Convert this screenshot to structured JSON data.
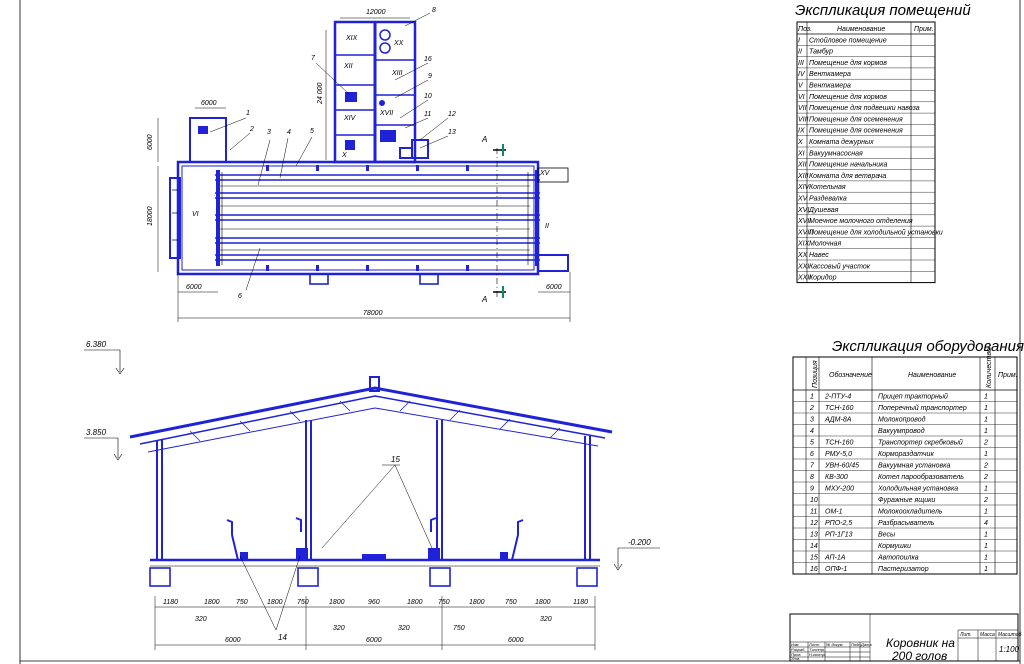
{
  "plan": {
    "dims": {
      "d_top": "12000",
      "d_top_left": "6000",
      "d_left_upper": "6000",
      "d_left_main": "18000",
      "d_vert_mid": "24 000",
      "d_bottom_left": "6000",
      "d_bottom_right": "6000",
      "d_total": "78000"
    },
    "callouts": [
      "1",
      "2",
      "3",
      "4",
      "5",
      "6",
      "7",
      "8",
      "9",
      "10",
      "11",
      "12",
      "13",
      "16"
    ],
    "section_marks": [
      "A",
      "A"
    ],
    "room_labels": [
      "VI",
      "II",
      "XIX",
      "XX",
      "XII",
      "XIII",
      "XIV",
      "XVII",
      "X",
      "XV"
    ]
  },
  "rooms_table": {
    "title": "Экспликация помещений",
    "headers": [
      "Поз.",
      "Наименование",
      "Прим."
    ],
    "rows": [
      [
        "I",
        "Стойловое помещение"
      ],
      [
        "II",
        "Тамбур"
      ],
      [
        "III",
        "Помещение для кормов"
      ],
      [
        "IV",
        "Венткамера"
      ],
      [
        "V",
        "Венткамера"
      ],
      [
        "VI",
        "Помещение для кормов"
      ],
      [
        "VII",
        "Помещение для подвешки навоза"
      ],
      [
        "VIII",
        "Помещение для осеменения"
      ],
      [
        "IX",
        "Помещение для осеменения"
      ],
      [
        "X",
        "Комната дежурных"
      ],
      [
        "XI",
        "Вакуумнасосная"
      ],
      [
        "XII",
        "Помещение начальника"
      ],
      [
        "XIII",
        "Комната для ветврача"
      ],
      [
        "XIV",
        "Котельная"
      ],
      [
        "XV",
        "Раздевалка"
      ],
      [
        "XVI",
        "Душевая"
      ],
      [
        "XVII",
        "Моечное молочного отделения"
      ],
      [
        "XVIII",
        "Помещение для холодильной установки"
      ],
      [
        "XIX",
        "Молочная"
      ],
      [
        "XX",
        "Навес"
      ],
      [
        "XXI",
        "Кассовый участок"
      ],
      [
        "XXII",
        "Коридор"
      ]
    ]
  },
  "equipment_table": {
    "title": "Экспликация оборудования",
    "headers": [
      "Позиция",
      "Обозначение",
      "Наименование",
      "Количество",
      "Прим."
    ],
    "rows": [
      [
        "1",
        "2-ПТУ-4",
        "Прицеп тракторный",
        "1"
      ],
      [
        "2",
        "ТСН-160",
        "Поперечный транспортер",
        "1"
      ],
      [
        "3",
        "АДМ-8А",
        "Молокопровод",
        "1"
      ],
      [
        "4",
        "",
        "Вакуумпровод",
        "1"
      ],
      [
        "5",
        "ТСН-160",
        "Транспортер скребковый",
        "2"
      ],
      [
        "6",
        "РМУ-5,0",
        "Кормораздатчик",
        "1"
      ],
      [
        "7",
        "УВН-60/45",
        "Вакуумная установка",
        "2"
      ],
      [
        "8",
        "КВ-300",
        "Котел парообразователь",
        "2"
      ],
      [
        "9",
        "МХУ-200",
        "Холодильная установка",
        "1"
      ],
      [
        "10",
        "",
        "Фуражные ящики",
        "2"
      ],
      [
        "11",
        "ОМ-1",
        "Молокоохладитель",
        "1"
      ],
      [
        "12",
        "РПО-2,5",
        "Разбрасыватель",
        "4"
      ],
      [
        "13",
        "РП-1Г13",
        "Весы",
        "1"
      ],
      [
        "14",
        "",
        "Кормушки",
        "1"
      ],
      [
        "15",
        "АП-1А",
        "Автопоилка",
        "1"
      ],
      [
        "16",
        "ОПФ-1",
        "Пастеризатор",
        "1"
      ]
    ]
  },
  "section": {
    "elev_top": "6.380",
    "elev_mid": "3.850",
    "elev_ground": "-0.200",
    "callout_top": "15",
    "callout_bottom": "14",
    "dims_row": [
      "1180",
      "1800",
      "750",
      "1800",
      "750",
      "1800",
      "960",
      "1800",
      "750",
      "1800",
      "750",
      "1800",
      "1180"
    ],
    "dims_small": [
      "320",
      "320",
      "320",
      "320",
      "750"
    ],
    "bay_spans": [
      "6000",
      "6000",
      "6000"
    ]
  },
  "stamp": {
    "title_line1": "Коровник на",
    "title_line2": "200 голов",
    "scale": "1:100",
    "col_labels": [
      "Лит.",
      "Масса",
      "Масштаб"
    ],
    "row_labels": [
      "Изм.",
      "Лист",
      "№ докум.",
      "Подп.",
      "Дата",
      "Разраб.",
      "Пров.",
      "Т.контр.",
      "Н.контр.",
      "Утв."
    ]
  }
}
